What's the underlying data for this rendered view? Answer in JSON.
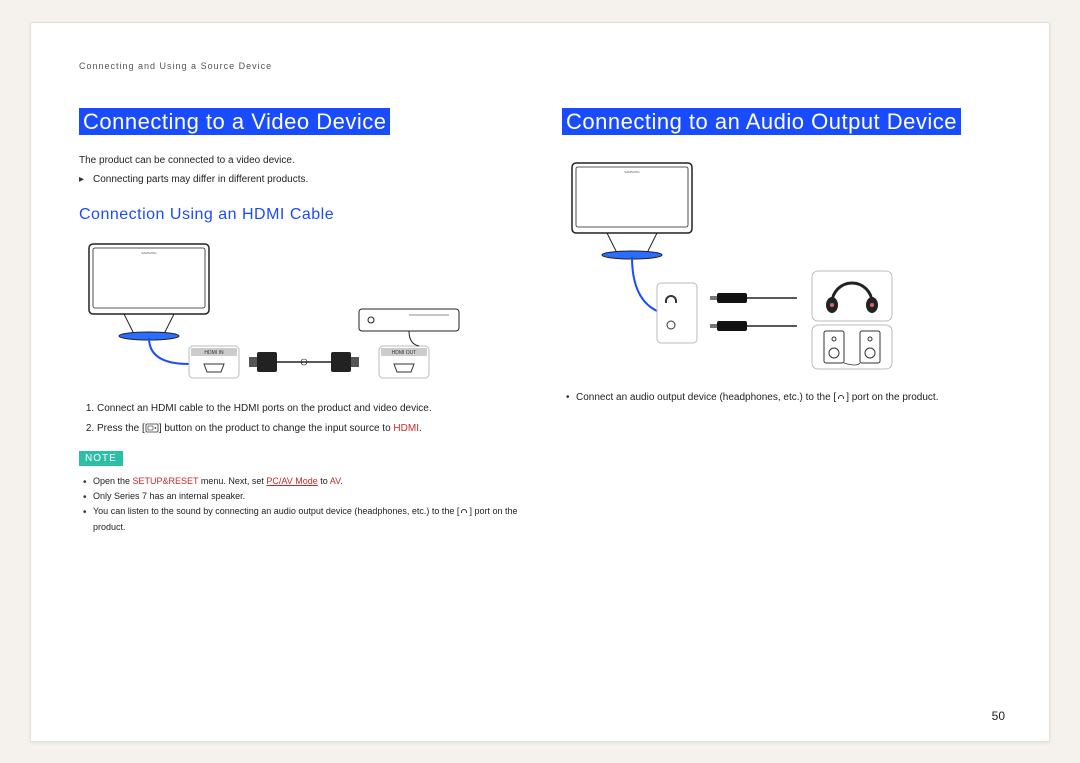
{
  "breadcrumb": "Connecting and Using a Source Device",
  "left": {
    "heading": "Connecting to a Video Device",
    "intro": "The product can be connected to a video device.",
    "note_bullet": "Connecting parts may differ in different products.",
    "sub_heading": "Connection Using an HDMI Cable",
    "port_in_label": "HDMI IN",
    "port_out_label": "HDMI OUT",
    "step1": "Connect an HDMI cable to the HDMI ports on the product and video device.",
    "step2_a": "Press the [",
    "step2_b": "] button on the product to change the input source to ",
    "step2_hdmi": "HDMI",
    "step2_c": ".",
    "note_label": "NOTE",
    "note1_a": "Open the ",
    "note1_b": "SETUP&RESET",
    "note1_c": " menu. Next, set ",
    "note1_d": "PC/AV Mode",
    "note1_e": " to ",
    "note1_f": "AV",
    "note1_g": ".",
    "note2": "Only Series 7 has an internal speaker.",
    "note3_a": "You can listen to the sound by connecting an audio output device (headphones, etc.) to the [",
    "note3_b": "] port on the product."
  },
  "right": {
    "heading": "Connecting to an Audio Output Device",
    "bullet_a": "Connect an audio output device (headphones, etc.) to the [",
    "bullet_b": "] port on the product."
  },
  "page_number": "50"
}
